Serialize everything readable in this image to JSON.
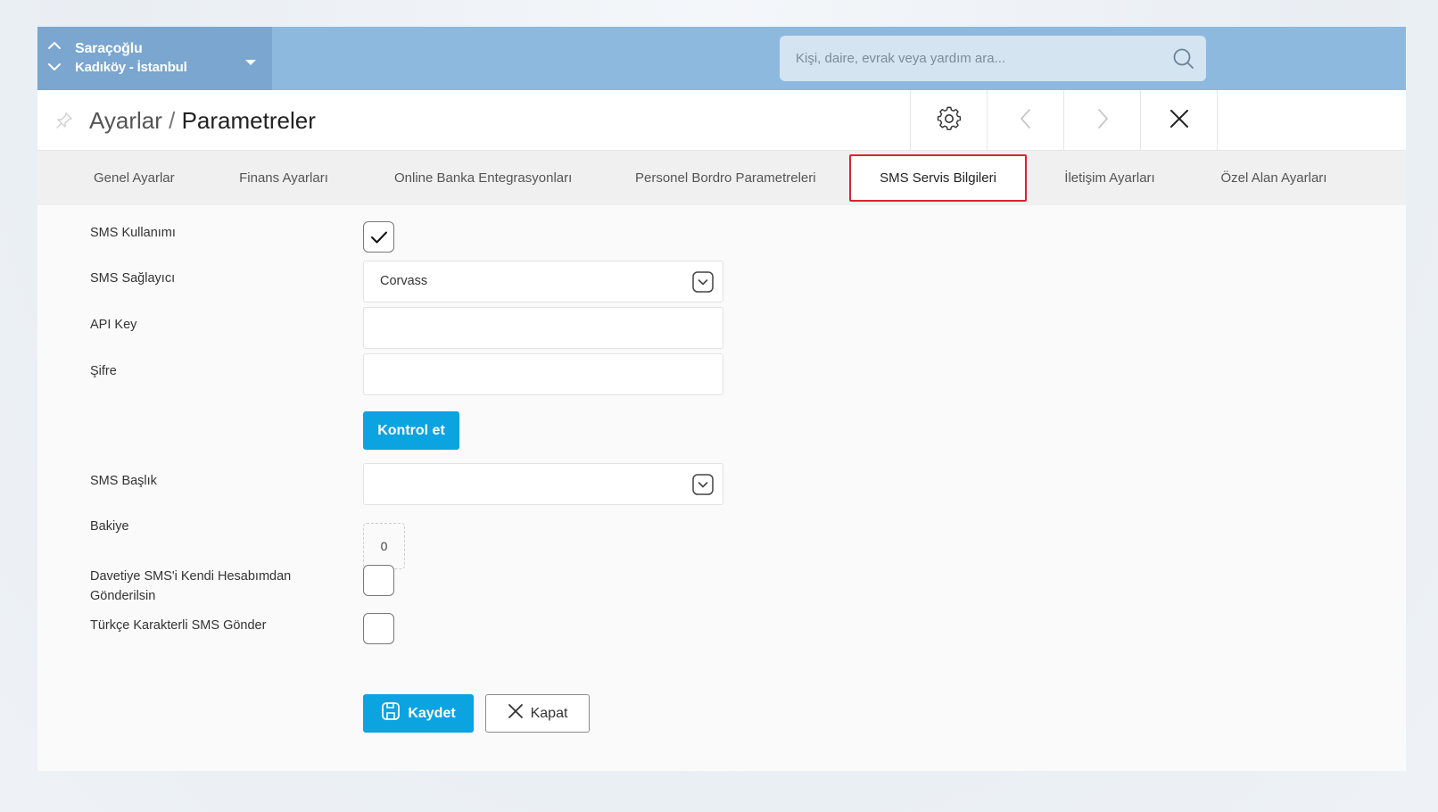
{
  "topbar": {
    "site_name": "Saraçoğlu",
    "site_location": "Kadıköy - İstanbul",
    "search_placeholder": "Kişi, daire, evrak veya yardım ara..."
  },
  "header": {
    "breadcrumb_parent": "Ayarlar",
    "breadcrumb_separator": "/",
    "breadcrumb_current": "Parametreler"
  },
  "tabs": [
    {
      "label": "Genel Ayarlar"
    },
    {
      "label": "Finans Ayarları"
    },
    {
      "label": "Online Banka Entegrasyonları"
    },
    {
      "label": "Personel Bordro Parametreleri"
    },
    {
      "label": "SMS Servis Bilgileri",
      "active": true
    },
    {
      "label": "İletişim Ayarları"
    },
    {
      "label": "Özel Alan Ayarları"
    }
  ],
  "form": {
    "sms_usage": {
      "label": "SMS Kullanımı",
      "checked": true
    },
    "sms_provider": {
      "label": "SMS Sağlayıcı",
      "value": "Corvass"
    },
    "api_key": {
      "label": "API Key",
      "value": ""
    },
    "password": {
      "label": "Şifre",
      "value": ""
    },
    "check_button": "Kontrol et",
    "sms_header": {
      "label": "SMS Başlık",
      "value": ""
    },
    "balance": {
      "label": "Bakiye",
      "value": "0"
    },
    "invite_own_account": {
      "label_line1": "Davetiye SMS'i Kendi Hesabımdan",
      "label_line2": "Gönderilsin",
      "checked": false
    },
    "turkish_chars": {
      "label": "Türkçe Karakterli SMS Gönder",
      "checked": false
    }
  },
  "actions": {
    "save_label": "Kaydet",
    "close_label": "Kapat"
  },
  "colors": {
    "topbar": "#8db9de",
    "site_switcher": "#7aa6cf",
    "primary_button": "#0ba3e0",
    "active_tab_border": "#d9252e"
  }
}
